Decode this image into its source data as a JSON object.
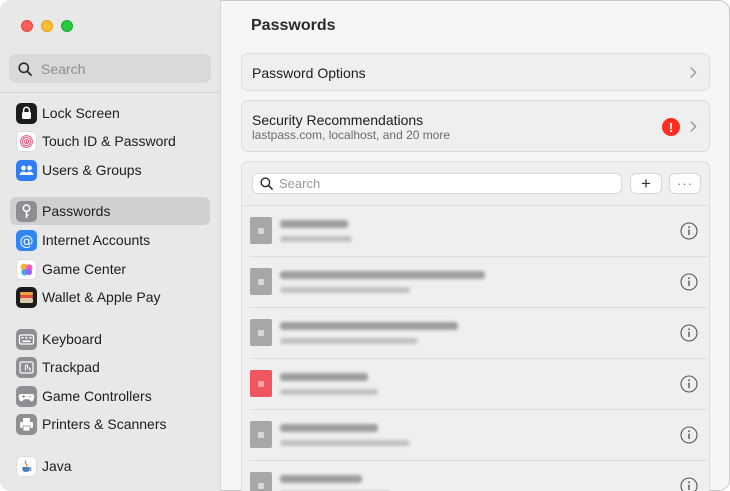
{
  "sidebar": {
    "search_placeholder": "Search",
    "items": [
      {
        "label": "Lock Screen",
        "icon": "lock-icon"
      },
      {
        "label": "Touch ID & Password",
        "icon": "fingerprint-icon"
      },
      {
        "label": "Users & Groups",
        "icon": "users-icon"
      },
      {
        "label": "Passwords",
        "icon": "key-icon",
        "selected": true
      },
      {
        "label": "Internet Accounts",
        "icon": "at-sign-icon"
      },
      {
        "label": "Game Center",
        "icon": "game-center-icon"
      },
      {
        "label": "Wallet & Apple Pay",
        "icon": "wallet-icon"
      },
      {
        "label": "Keyboard",
        "icon": "keyboard-icon"
      },
      {
        "label": "Trackpad",
        "icon": "trackpad-icon"
      },
      {
        "label": "Game Controllers",
        "icon": "game-controller-icon"
      },
      {
        "label": "Printers & Scanners",
        "icon": "printer-icon"
      },
      {
        "label": "Java",
        "icon": "java-icon"
      }
    ]
  },
  "main": {
    "title": "Passwords",
    "password_options_label": "Password Options",
    "security": {
      "title": "Security Recommendations",
      "subtitle": "lastpass.com, localhost, and 20 more",
      "badge": "!"
    },
    "list": {
      "search_placeholder": "Search",
      "add_label": "+",
      "more_label": "···"
    }
  },
  "colors": {
    "alert": "#ff2d20",
    "selected_item": "#d0d0d0"
  }
}
